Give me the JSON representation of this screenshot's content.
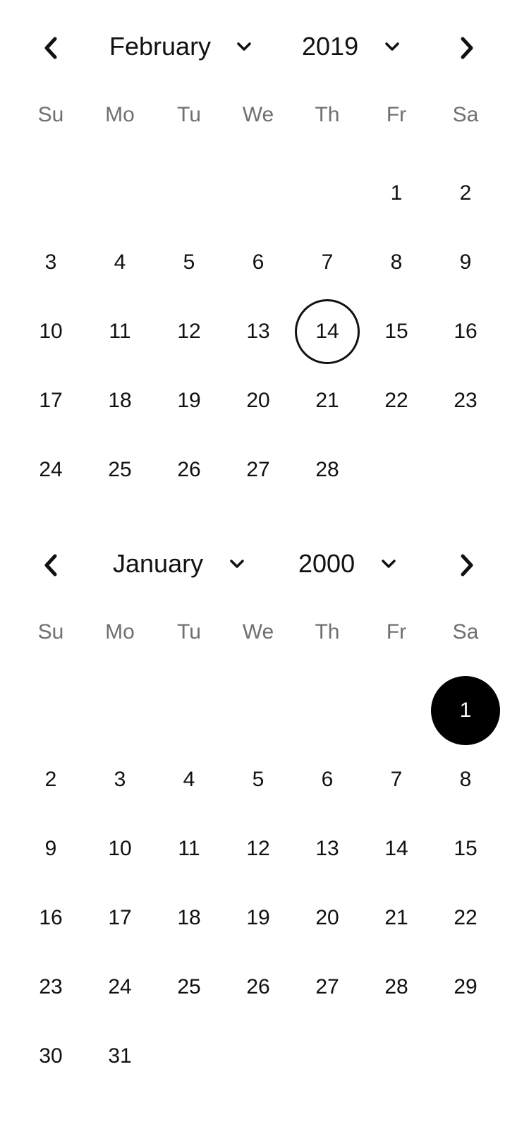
{
  "calendars": [
    {
      "month": "February",
      "year": "2019",
      "weekdays": [
        "Su",
        "Mo",
        "Tu",
        "We",
        "Th",
        "Fr",
        "Sa"
      ],
      "lead_blanks": 5,
      "days": [
        "1",
        "2",
        "3",
        "4",
        "5",
        "6",
        "7",
        "8",
        "9",
        "10",
        "11",
        "12",
        "13",
        "14",
        "15",
        "16",
        "17",
        "18",
        "19",
        "20",
        "21",
        "22",
        "23",
        "24",
        "25",
        "26",
        "27",
        "28"
      ],
      "today": "14",
      "selected": null,
      "icons": {
        "prev": "chevron-left-icon",
        "next": "chevron-right-icon",
        "dropdown": "chevron-down-icon"
      }
    },
    {
      "month": "January",
      "year": "2000",
      "weekdays": [
        "Su",
        "Mo",
        "Tu",
        "We",
        "Th",
        "Fr",
        "Sa"
      ],
      "lead_blanks": 6,
      "days": [
        "1",
        "2",
        "3",
        "4",
        "5",
        "6",
        "7",
        "8",
        "9",
        "10",
        "11",
        "12",
        "13",
        "14",
        "15",
        "16",
        "17",
        "18",
        "19",
        "20",
        "21",
        "22",
        "23",
        "24",
        "25",
        "26",
        "27",
        "28",
        "29",
        "30",
        "31"
      ],
      "today": null,
      "selected": "1",
      "icons": {
        "prev": "chevron-left-icon",
        "next": "chevron-right-icon",
        "dropdown": "chevron-down-icon"
      }
    }
  ],
  "colors": {
    "text": "#111111",
    "weekday_text": "#707070",
    "selected_fill": "#000000",
    "selected_text": "#ffffff",
    "today_ring": "#111111"
  }
}
